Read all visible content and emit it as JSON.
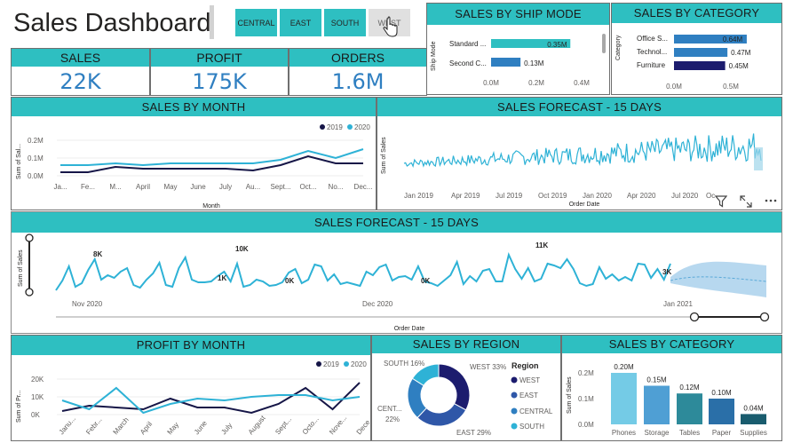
{
  "header": {
    "title": "Sales Dashboard",
    "slicer": [
      "CENTRAL",
      "EAST",
      "SOUTH",
      "WEST"
    ]
  },
  "kpis": [
    {
      "label": "SALES",
      "value": "22K"
    },
    {
      "label": "PROFIT",
      "value": "175K"
    },
    {
      "label": "ORDERS",
      "value": "1.6M"
    }
  ],
  "ship_mode": {
    "title": "SALES BY SHIP MODE",
    "axis_title": "Ship Mode",
    "rows": [
      {
        "label": "Standard ...",
        "value_label": "0.35M"
      },
      {
        "label": "Second C...",
        "value_label": "0.13M"
      }
    ],
    "ticks": [
      "0.0M",
      "0.2M",
      "0.4M"
    ]
  },
  "category_top": {
    "title": "SALES BY CATEGORY",
    "axis_title": "Category",
    "rows": [
      {
        "label": "Office S...",
        "value_label": "0.64M"
      },
      {
        "label": "Technol...",
        "value_label": "0.47M"
      },
      {
        "label": "Furniture",
        "value_label": "0.45M"
      }
    ],
    "ticks": [
      "0.0M",
      "0.5M"
    ]
  },
  "sales_by_month": {
    "title": "SALES BY MONTH",
    "ylabel": "Sum of Sal...",
    "xlabel": "Month",
    "legend": [
      "2019",
      "2020"
    ],
    "yticks": [
      "0.2M",
      "0.1M",
      "0.0M"
    ],
    "xticks": [
      "Ja...",
      "Fe...",
      "M...",
      "April",
      "May",
      "June",
      "July",
      "Au...",
      "Sept...",
      "Oct...",
      "No...",
      "Dec..."
    ]
  },
  "forecast_small": {
    "title": "SALES FORECAST - 15 DAYS",
    "ylabel": "Sum of Sales",
    "xlabel": "Order Date",
    "xticks": [
      "Jan 2019",
      "Apr 2019",
      "Jul 2019",
      "Oct 2019",
      "Jan 2020",
      "Apr 2020",
      "Jul 2020",
      "Oc"
    ]
  },
  "forecast_large": {
    "title": "SALES FORECAST - 15 DAYS",
    "ylabel": "Sum of Sales",
    "xlabel": "Order Date",
    "xticks": [
      "Nov 2020",
      "Dec 2020",
      "Jan 2021"
    ],
    "labels": [
      "8K",
      "10K",
      "1K",
      "0K",
      "0K",
      "11K",
      "3K"
    ]
  },
  "profit_by_month": {
    "title": "PROFIT BY MONTH",
    "ylabel": "Sum of Pr...",
    "legend": [
      "2019",
      "2020"
    ],
    "yticks": [
      "20K",
      "10K",
      "0K"
    ],
    "xticks": [
      "Janu...",
      "Febr...",
      "March",
      "April",
      "May",
      "June",
      "July",
      "August",
      "Sept...",
      "Octo...",
      "Nove...",
      "Dece..."
    ]
  },
  "sales_by_region": {
    "title": "SALES BY REGION",
    "legend_title": "Region",
    "legend": [
      "WEST",
      "EAST",
      "CENTRAL",
      "SOUTH"
    ],
    "labels": [
      "SOUTH 16%",
      "WEST 33%",
      "CENT...",
      "22%",
      "EAST 29%"
    ]
  },
  "category_bottom": {
    "title": "SALES BY CATEGORY",
    "ylabel": "Sum of Sales",
    "yticks": [
      "0.2M",
      "0.1M",
      "0.0M"
    ]
  },
  "chart_data": [
    {
      "type": "bar",
      "title": "SALES BY SHIP MODE",
      "categories": [
        "Standard ...",
        "Second C..."
      ],
      "values": [
        0.35,
        0.13
      ],
      "xlim": [
        0,
        0.4
      ],
      "colors": [
        "#2ebfc1",
        "#2f7fc1"
      ]
    },
    {
      "type": "bar",
      "title": "SALES BY CATEGORY",
      "categories": [
        "Office S...",
        "Technol...",
        "Furniture"
      ],
      "values": [
        0.64,
        0.47,
        0.45
      ],
      "xlim": [
        0,
        0.7
      ],
      "colors": [
        "#2f7fc1",
        "#2f7fc1",
        "#1c1c6e"
      ]
    },
    {
      "type": "line",
      "title": "SALES BY MONTH",
      "categories": [
        "Ja...",
        "Fe...",
        "M...",
        "April",
        "May",
        "June",
        "July",
        "Au...",
        "Sept...",
        "Oct...",
        "No...",
        "Dec..."
      ],
      "series": [
        {
          "name": "2019",
          "color": "#161647",
          "values": [
            0.02,
            0.02,
            0.05,
            0.04,
            0.04,
            0.04,
            0.04,
            0.03,
            0.06,
            0.11,
            0.07,
            0.07
          ]
        },
        {
          "name": "2020",
          "color": "#2eb2d6",
          "values": [
            0.06,
            0.06,
            0.07,
            0.06,
            0.07,
            0.07,
            0.07,
            0.07,
            0.09,
            0.14,
            0.1,
            0.15
          ]
        }
      ],
      "ylim": [
        0,
        0.22
      ]
    },
    {
      "type": "line",
      "title": "PROFIT BY MONTH",
      "categories": [
        "Janu...",
        "Febr...",
        "March",
        "April",
        "May",
        "June",
        "July",
        "August",
        "Sept...",
        "Octo...",
        "Nove...",
        "Dece..."
      ],
      "series": [
        {
          "name": "2019",
          "color": "#161647",
          "values": [
            2,
            5,
            4,
            3,
            9,
            4,
            4,
            1,
            6,
            15,
            3,
            18
          ]
        },
        {
          "name": "2020",
          "color": "#2eb2d6",
          "values": [
            8,
            3,
            15,
            1,
            6,
            9,
            8,
            10,
            11,
            11,
            8,
            10
          ]
        }
      ],
      "ylim": [
        -2,
        27
      ]
    },
    {
      "type": "pie",
      "title": "SALES BY REGION",
      "categories": [
        "WEST",
        "EAST",
        "CENTRAL",
        "SOUTH"
      ],
      "values": [
        33,
        29,
        22,
        16
      ],
      "colors": [
        "#1c1c6e",
        "#2f57a8",
        "#2f7fc1",
        "#2eb2d6"
      ]
    },
    {
      "type": "bar",
      "title": "SALES BY CATEGORY",
      "categories": [
        "Phones",
        "Storage",
        "Tables",
        "Paper",
        "Supplies"
      ],
      "values": [
        0.2,
        0.15,
        0.12,
        0.1,
        0.04
      ],
      "value_labels": [
        "0.20M",
        "0.15M",
        "0.12M",
        "0.10M",
        "0.04M"
      ],
      "ylim": [
        0,
        0.25
      ],
      "colors": [
        "#74cbe6",
        "#4f9fd4",
        "#2d8a9a",
        "#2a6fa8",
        "#195c6e"
      ]
    }
  ]
}
